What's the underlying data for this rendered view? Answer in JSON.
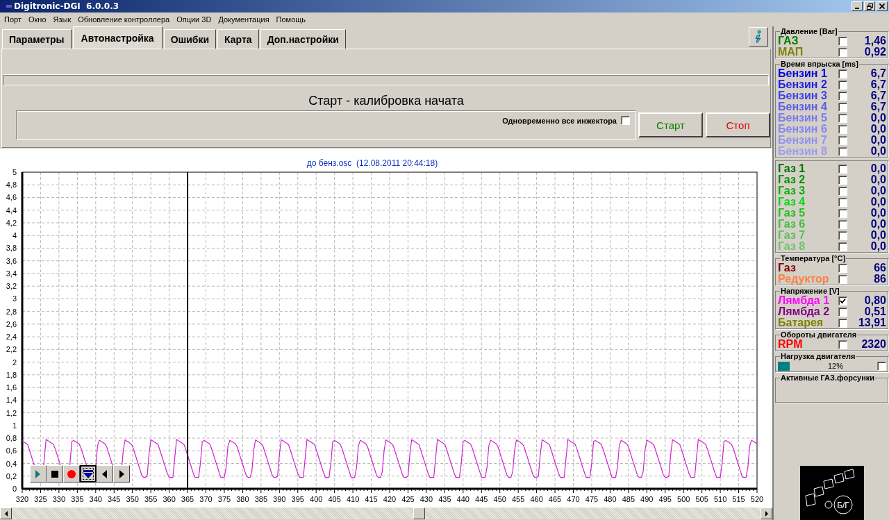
{
  "window": {
    "title": "Digitronic-DGI  6.0.0.3"
  },
  "menu": [
    "Порт",
    "Окно",
    "Язык",
    "Обновление контроллера",
    "Опции 3D",
    "Документация",
    "Помощь"
  ],
  "tabs": [
    {
      "label": "Параметры",
      "selected": false
    },
    {
      "label": "Автонастройка",
      "selected": true
    },
    {
      "label": "Ошибки",
      "selected": false
    },
    {
      "label": "Карта",
      "selected": false
    },
    {
      "label": "Доп.настройки",
      "selected": false
    }
  ],
  "calibration": {
    "status": "Старт - калибровка начата",
    "all_injectors": {
      "label": "Одновременно все инжектора",
      "checked": false
    },
    "buttons": [
      {
        "label": "Старт",
        "color": "#008000"
      },
      {
        "label": "Стоп",
        "color": "#e00000"
      }
    ]
  },
  "chart": {
    "title": "до бенз.osc  (12.08.2011 20:44:18)",
    "yticks": [
      "5",
      "4,8",
      "4,6",
      "4,4",
      "4,2",
      "4",
      "3,8",
      "3,6",
      "3,4",
      "3,2",
      "3",
      "2,8",
      "2,6",
      "2,4",
      "2,2",
      "2",
      "1,8",
      "1,6",
      "1,4",
      "1,2",
      "1",
      "0,8",
      "0,6",
      "0,4",
      "0,2",
      "0"
    ],
    "xticks": [
      "320",
      "325",
      "330",
      "335",
      "340",
      "345",
      "350",
      "355",
      "360",
      "365",
      "370",
      "375",
      "380",
      "385",
      "390",
      "395",
      "400",
      "405",
      "410",
      "415",
      "420",
      "425",
      "430",
      "435",
      "440",
      "445",
      "450",
      "455",
      "460",
      "465",
      "470",
      "475",
      "480",
      "485",
      "490",
      "495",
      "500",
      "505",
      "510",
      "515",
      "520"
    ],
    "cursor": {
      "level": 0.225
    },
    "controls": [
      {
        "kind": "play",
        "pressed": false
      },
      {
        "kind": "stop",
        "pressed": false
      },
      {
        "kind": "record",
        "pressed": false
      },
      {
        "kind": "down",
        "pressed": true
      },
      {
        "kind": "left",
        "pressed": false
      },
      {
        "kind": "right",
        "pressed": false
      }
    ]
  },
  "sensor_panel": [
    {
      "kind": "rows",
      "title": "Давление [Bar]",
      "rows": [
        {
          "label": "ГАЗ",
          "color": "#008000",
          "checked": false,
          "value": "1,46"
        },
        {
          "label": "МАП",
          "color": "#808000",
          "checked": false,
          "value": "0,92"
        }
      ]
    },
    {
      "kind": "rows",
      "title": "Время впрыска [ms]",
      "rows": [
        {
          "label": "Бензин 1",
          "color": "#0000e0",
          "checked": false,
          "value": "6,7"
        },
        {
          "label": "Бензин 2",
          "color": "#2020e8",
          "checked": false,
          "value": "6,7"
        },
        {
          "label": "Бензин 3",
          "color": "#4040e8",
          "checked": false,
          "value": "6,7"
        },
        {
          "label": "Бензин 4",
          "color": "#5c5ce8",
          "checked": false,
          "value": "6,7"
        },
        {
          "label": "Бензин 5",
          "color": "#7878f0",
          "checked": false,
          "value": "0,0"
        },
        {
          "label": "Бензин 6",
          "color": "#8484f0",
          "checked": false,
          "value": "0,0"
        },
        {
          "label": "Бензин 7",
          "color": "#9090f0",
          "checked": false,
          "value": "0,0"
        },
        {
          "label": "Бензин 8",
          "color": "#9c9cf0",
          "checked": false,
          "value": "0,0"
        }
      ]
    },
    {
      "kind": "rows",
      "rows": [
        {
          "label": "Газ 1",
          "color": "#007000",
          "checked": false,
          "value": "0,0"
        },
        {
          "label": "Газ 2",
          "color": "#009000",
          "checked": false,
          "value": "0,0"
        },
        {
          "label": "Газ 3",
          "color": "#00b000",
          "checked": false,
          "value": "0,0"
        },
        {
          "label": "Газ 4",
          "color": "#00d800",
          "checked": false,
          "value": "0,0"
        },
        {
          "label": "Газ 5",
          "color": "#20c020",
          "checked": false,
          "value": "0,0"
        },
        {
          "label": "Газ 6",
          "color": "#40c040",
          "checked": false,
          "value": "0,0"
        },
        {
          "label": "Газ 7",
          "color": "#58c058",
          "checked": false,
          "value": "0,0"
        },
        {
          "label": "Газ 8",
          "color": "#70c070",
          "checked": false,
          "value": "0,0"
        }
      ]
    },
    {
      "kind": "rows",
      "title": "Температура  [°C]",
      "rows": [
        {
          "label": "Газ",
          "color": "#800000",
          "checked": false,
          "value": "66"
        },
        {
          "label": "Редуктор",
          "color": "#ff8040",
          "checked": false,
          "value": "86"
        }
      ]
    },
    {
      "kind": "rows",
      "title": "Напряжение [V]",
      "rows": [
        {
          "label": "Лямбда 1",
          "color": "#ff00ff",
          "checked": true,
          "value": "0,80"
        },
        {
          "label": "Лямбда 2",
          "color": "#800080",
          "checked": false,
          "value": "0,51"
        },
        {
          "label": "Батарея",
          "color": "#808000",
          "checked": false,
          "value": "13,91"
        }
      ]
    },
    {
      "kind": "rows",
      "title": "Обороты двигателя",
      "rows": [
        {
          "label": "RPM",
          "color": "#ff0000",
          "checked": false,
          "value": "2320"
        }
      ]
    },
    {
      "kind": "bar",
      "title": "Нагрузка двигателя",
      "level": 0.12,
      "reading": "12%",
      "checked": false
    },
    {
      "kind": "empty",
      "title": "Активные ГАЗ.форсунки"
    }
  ],
  "indicator": {
    "label": "Б/Г"
  }
}
